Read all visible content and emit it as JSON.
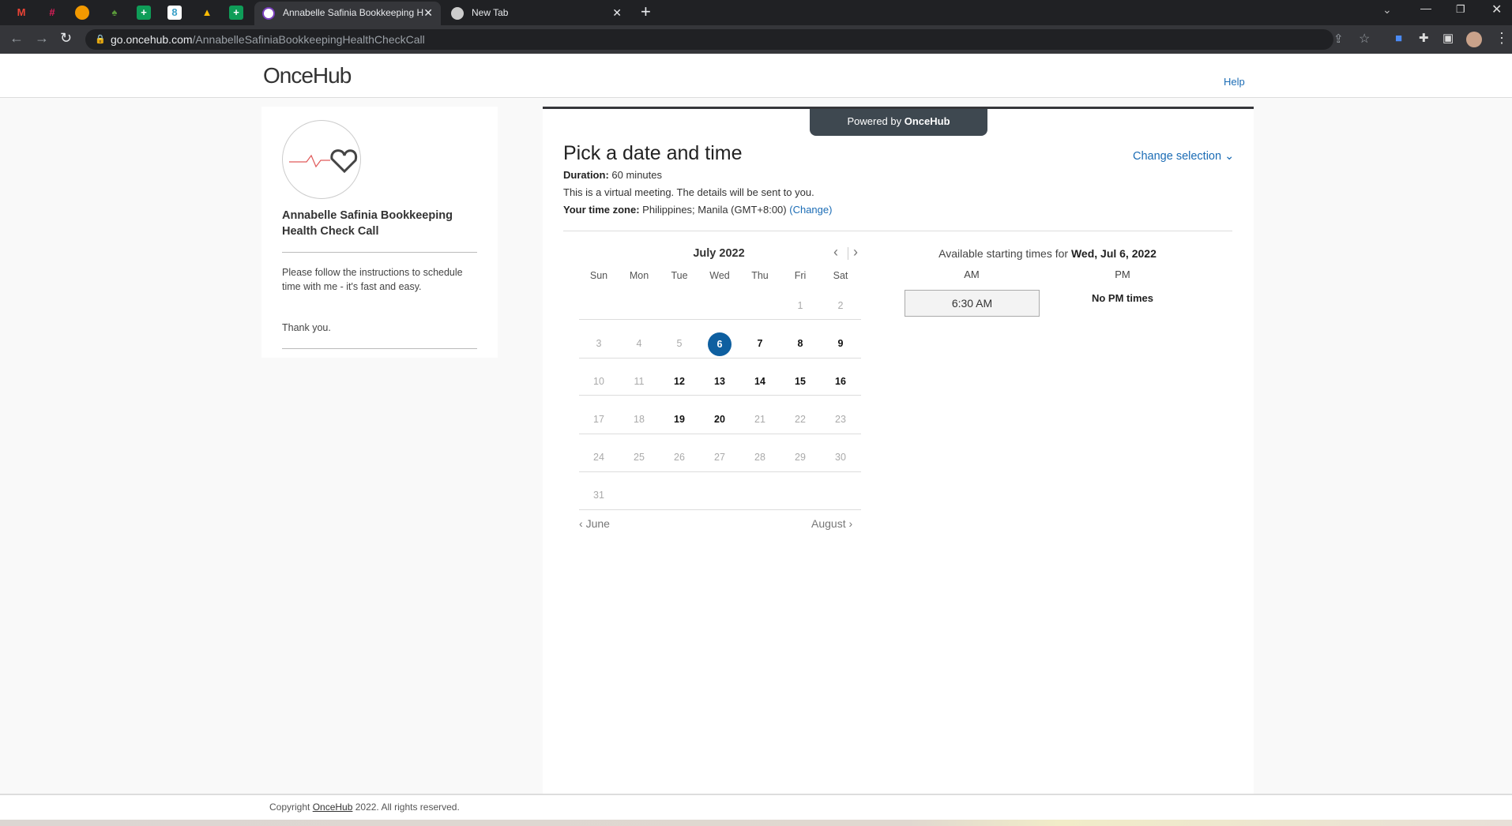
{
  "browser": {
    "pinned_tabs": [
      "gmail",
      "slack",
      "app",
      "maps",
      "sheets",
      "app2",
      "drive",
      "sheets2"
    ],
    "tabs": [
      {
        "title": "Annabelle Safinia Bookkeeping H",
        "active": true
      },
      {
        "title": "New Tab",
        "active": false
      }
    ],
    "url_host": "go.oncehub.com",
    "url_path": "/AnnabelleSafiniaBookkeepingHealthCheckCall"
  },
  "header": {
    "logo": "OnceHub",
    "help": "Help"
  },
  "left": {
    "title": "Annabelle Safinia Bookkeeping Health Check Call",
    "instructions": "Please follow the instructions to schedule time with me - it's fast and easy.",
    "thanks": "Thank you."
  },
  "main": {
    "powered_prefix": "Powered by ",
    "powered_brand": "OnceHub",
    "title": "Pick a date and time",
    "change_selection": "Change selection",
    "duration_label": "Duration:",
    "duration": "60 minutes",
    "virtual": "This is a virtual meeting. The details will be sent to you.",
    "tz_label": "Your time zone:",
    "tz": "Philippines;  Manila  (GMT+8:00)",
    "tz_change": "(Change)"
  },
  "calendar": {
    "month": "July 2022",
    "weekdays": [
      "Sun",
      "Mon",
      "Tue",
      "Wed",
      "Thu",
      "Fri",
      "Sat"
    ],
    "first_weekday": 5,
    "days": 31,
    "selected": 6,
    "available": [
      6,
      7,
      8,
      9,
      12,
      13,
      14,
      15,
      16,
      19,
      20
    ],
    "prev": "June",
    "next": "August"
  },
  "times": {
    "label": "Available starting times for ",
    "date": "Wed, Jul 6, 2022",
    "am": "AM",
    "pm": "PM",
    "am_slots": [
      "6:30 AM"
    ],
    "pm_empty": "No PM times"
  },
  "footer": {
    "prefix": "Copyright ",
    "link": "OnceHub",
    "suffix": " 2022. All rights reserved."
  },
  "colors": {
    "accent": "#1b6cb5",
    "selected": "#0e5fa0"
  }
}
